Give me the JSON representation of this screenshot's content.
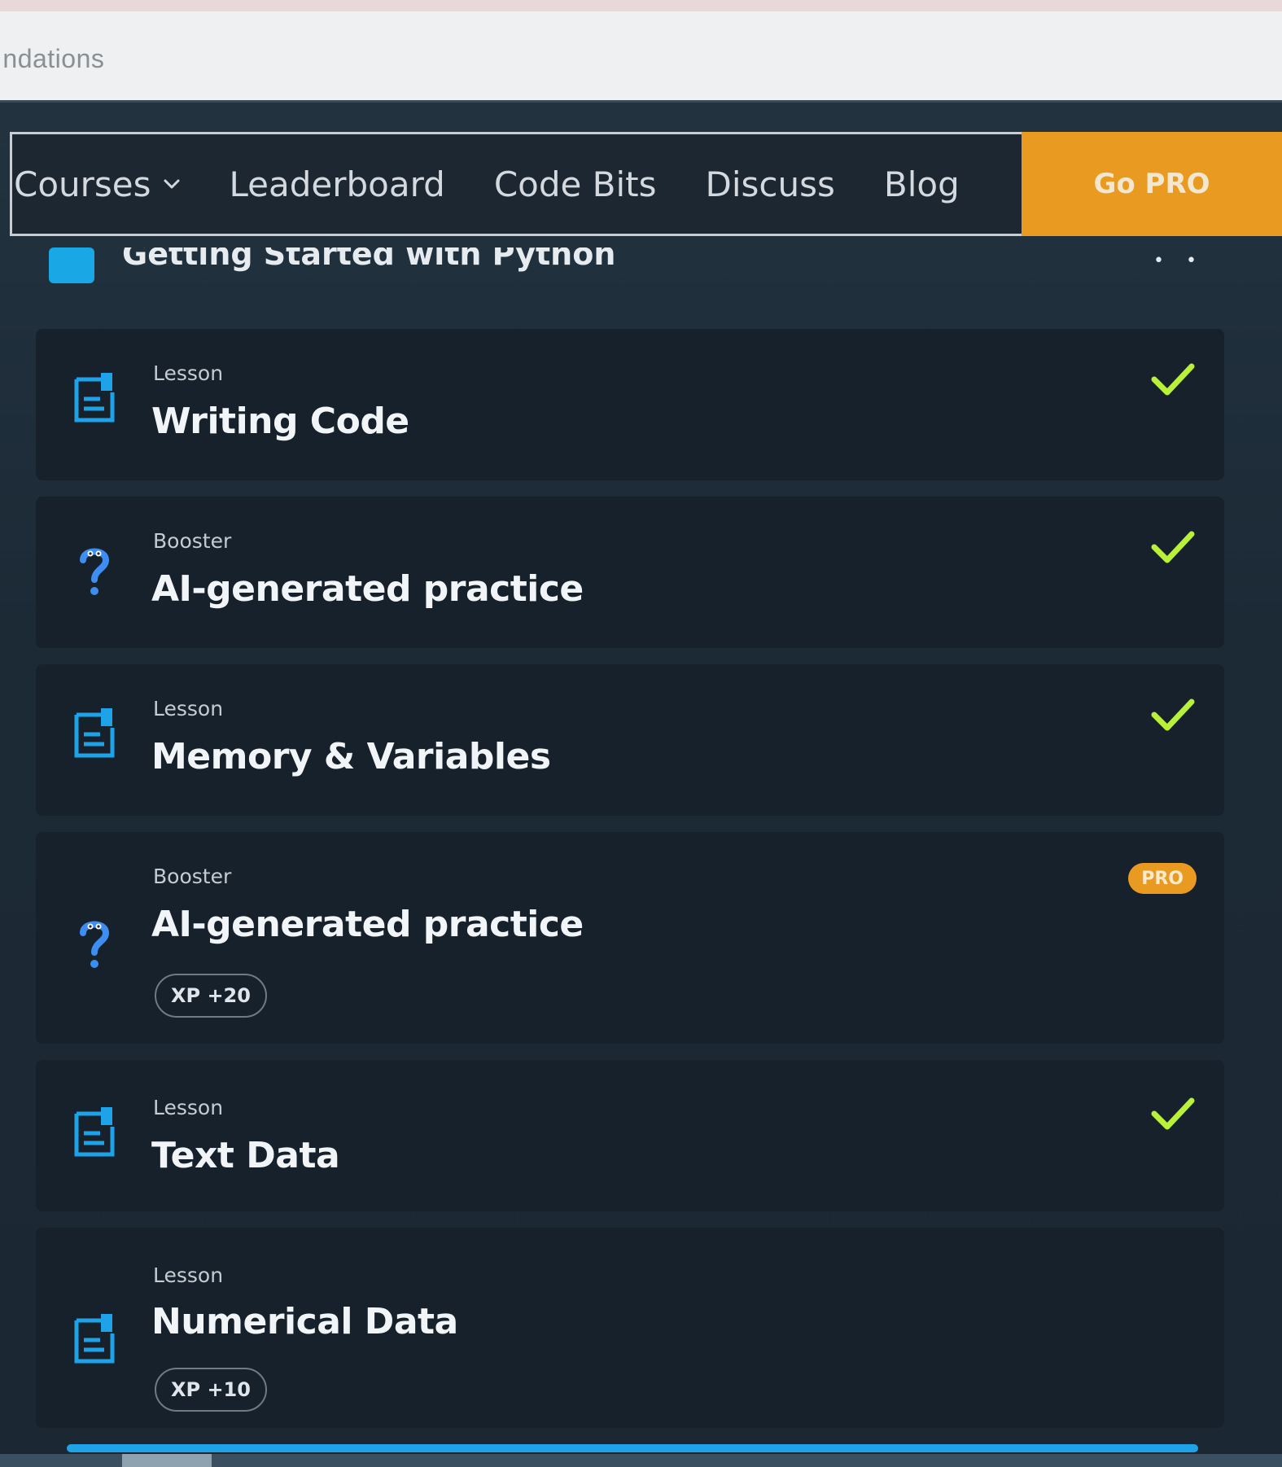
{
  "breadcrumb": {
    "text": "ındations"
  },
  "nav": {
    "items": [
      {
        "label": "Courses",
        "has_dropdown": true
      },
      {
        "label": "Leaderboard"
      },
      {
        "label": "Code Bits"
      },
      {
        "label": "Discuss"
      },
      {
        "label": "Blog"
      }
    ],
    "go_pro": "Go PRO"
  },
  "section": {
    "title": "Getting Started with Python",
    "more_icon": "ellipsis-icon"
  },
  "cards": [
    {
      "type": "Lesson",
      "title": "Writing Code",
      "icon": "lesson-document-icon",
      "status": "completed"
    },
    {
      "type": "Booster",
      "title": "AI-generated practice",
      "icon": "booster-question-icon",
      "status": "completed"
    },
    {
      "type": "Lesson",
      "title": "Memory & Variables",
      "icon": "lesson-document-icon",
      "status": "completed"
    },
    {
      "type": "Booster",
      "title": "AI-generated practice",
      "icon": "booster-question-icon",
      "status": "pro",
      "badge": "PRO",
      "xp": "XP +20"
    },
    {
      "type": "Lesson",
      "title": "Text Data",
      "icon": "lesson-document-icon",
      "status": "completed"
    },
    {
      "type": "Lesson",
      "title": "Numerical Data",
      "icon": "lesson-document-icon",
      "status": "open",
      "xp": "XP +10"
    }
  ],
  "colors": {
    "accent": "#1fa3e8",
    "pro": "#e89a21",
    "check": "#b8f03a",
    "card": "#17212b"
  }
}
